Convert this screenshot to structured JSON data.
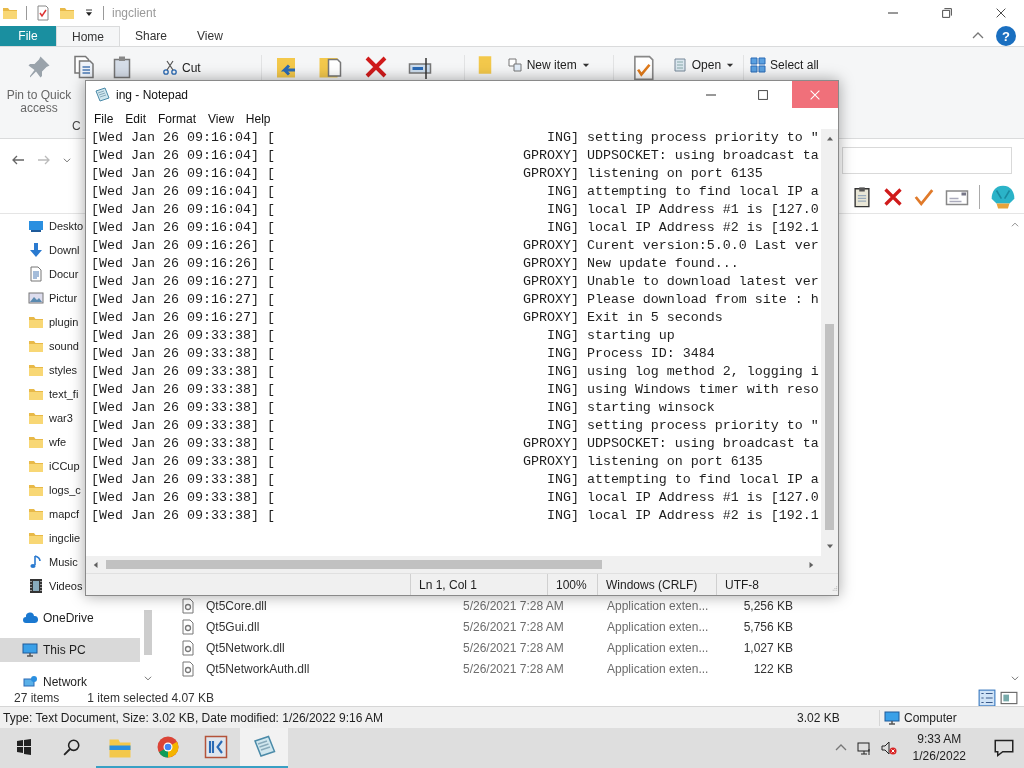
{
  "explorer": {
    "title": "ingclient",
    "ribbon_tabs": [
      {
        "label": "File",
        "kind": "menu",
        "selected": false
      },
      {
        "label": "Home",
        "kind": "tab",
        "selected": true
      },
      {
        "label": "Share",
        "kind": "tab",
        "selected": false
      },
      {
        "label": "View",
        "kind": "tab",
        "selected": false
      }
    ],
    "help": "?",
    "ribbon": {
      "pin": "Pin to Quick access",
      "copy": "C",
      "cut": "Cut",
      "new_item": "New item",
      "open": "Open",
      "select_all": "Select all"
    },
    "nav_items": [
      {
        "label": "Deskto",
        "kind": "desktop",
        "selected": false
      },
      {
        "label": "Downl",
        "kind": "download",
        "selected": false
      },
      {
        "label": "Docur",
        "kind": "documents",
        "selected": false
      },
      {
        "label": "Pictur",
        "kind": "pictures",
        "selected": false
      },
      {
        "label": "plugin",
        "kind": "folder",
        "selected": false
      },
      {
        "label": "sound",
        "kind": "folder",
        "selected": false
      },
      {
        "label": "styles",
        "kind": "folder",
        "selected": false
      },
      {
        "label": "text_fi",
        "kind": "folder",
        "selected": false
      },
      {
        "label": "war3",
        "kind": "folder",
        "selected": false
      },
      {
        "label": "wfe",
        "kind": "folder",
        "selected": false
      },
      {
        "label": "iCCup",
        "kind": "folder",
        "selected": false
      },
      {
        "label": "logs_c",
        "kind": "folder",
        "selected": false
      },
      {
        "label": "mapcf",
        "kind": "folder",
        "selected": false
      },
      {
        "label": "ingclie",
        "kind": "folder",
        "selected": false
      },
      {
        "label": "Music",
        "kind": "music",
        "selected": false
      },
      {
        "label": "Videos",
        "kind": "videos",
        "selected": false
      },
      {
        "label": "OneDrive",
        "kind": "cloud",
        "selected": false
      },
      {
        "label": "This PC",
        "kind": "pc",
        "selected": true
      },
      {
        "label": "Network",
        "kind": "network",
        "selected": false
      }
    ],
    "files": [
      {
        "name": "Qt5Core.dll",
        "modified": "5/26/2021 7:28 AM",
        "type": "Application exten...",
        "size": "5,256 KB"
      },
      {
        "name": "Qt5Gui.dll",
        "modified": "5/26/2021 7:28 AM",
        "type": "Application exten...",
        "size": "5,756 KB"
      },
      {
        "name": "Qt5Network.dll",
        "modified": "5/26/2021 7:28 AM",
        "type": "Application exten...",
        "size": "1,027 KB"
      },
      {
        "name": "Qt5NetworkAuth.dll",
        "modified": "5/26/2021 7:28 AM",
        "type": "Application exten...",
        "size": "122 KB"
      }
    ],
    "status": {
      "count": "27 items",
      "selection": "1 item selected  4.07 KB"
    },
    "details_bar": {
      "text": "Type: Text Document, Size: 3.02 KB, Date modified: 1/26/2022 9:16 AM",
      "size": "3.02 KB",
      "zone": "Computer"
    }
  },
  "notepad": {
    "title": "ing - Notepad",
    "menu": [
      "File",
      "Edit",
      "Format",
      "View",
      "Help"
    ],
    "lines": [
      "[Wed Jan 26 09:16:04] [                                  ING] setting process priority to \"",
      "[Wed Jan 26 09:16:04] [                               GPROXY] UDPSOCKET: using broadcast ta",
      "[Wed Jan 26 09:16:04] [                               GPROXY] listening on port 6135",
      "[Wed Jan 26 09:16:04] [                                  ING] attempting to find local IP a",
      "[Wed Jan 26 09:16:04] [                                  ING] local IP Address #1 is [127.0",
      "[Wed Jan 26 09:16:04] [                                  ING] local IP Address #2 is [192.1",
      "[Wed Jan 26 09:16:26] [                               GPROXY] Curent version:5.0.0 Last ver",
      "[Wed Jan 26 09:16:26] [                               GPROXY] New update found...",
      "[Wed Jan 26 09:16:27] [                               GPROXY] Unable to download latest ver",
      "[Wed Jan 26 09:16:27] [                               GPROXY] Please download from site : h",
      "[Wed Jan 26 09:16:27] [                               GPROXY] Exit in 5 seconds",
      "[Wed Jan 26 09:33:38] [                                  ING] starting up",
      "[Wed Jan 26 09:33:38] [                                  ING] Process ID: 3484",
      "[Wed Jan 26 09:33:38] [                                  ING] using log method 2, logging i",
      "[Wed Jan 26 09:33:38] [                                  ING] using Windows timer with reso",
      "[Wed Jan 26 09:33:38] [                                  ING] starting winsock",
      "[Wed Jan 26 09:33:38] [                                  ING] setting process priority to \"",
      "[Wed Jan 26 09:33:38] [                               GPROXY] UDPSOCKET: using broadcast ta",
      "[Wed Jan 26 09:33:38] [                               GPROXY] listening on port 6135",
      "[Wed Jan 26 09:33:38] [                                  ING] attempting to find local IP a",
      "[Wed Jan 26 09:33:38] [                                  ING] local IP Address #1 is [127.0",
      "[Wed Jan 26 09:33:38] [                                  ING] local IP Address #2 is [192.1"
    ],
    "status": {
      "position": "Ln 1, Col 1",
      "zoom": "100%",
      "line_ending": "Windows (CRLF)",
      "encoding": "UTF-8"
    }
  },
  "taskbar": {
    "apps": [
      {
        "kind": "explorer",
        "running": true,
        "active": false
      },
      {
        "kind": "browser",
        "running": true,
        "active": false
      },
      {
        "kind": "app",
        "running": true,
        "active": false
      },
      {
        "kind": "notepad",
        "running": true,
        "active": true
      }
    ],
    "time": "9:33 AM",
    "date": "1/26/2022"
  }
}
